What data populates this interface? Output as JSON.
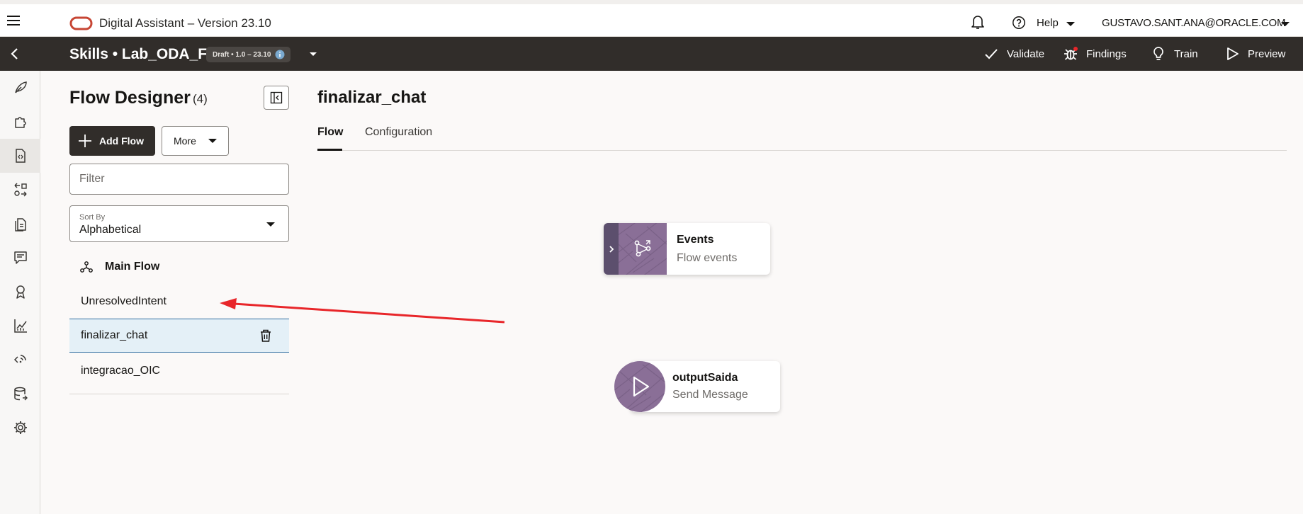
{
  "header": {
    "app_title": "Digital Assistant – Version 23.10",
    "help_label": "Help",
    "user": "GUSTAVO.SANT.ANA@ORACLE.COM"
  },
  "skillbar": {
    "title": "Skills • Lab_ODA_FT",
    "badge": "Draft • 1.0 – 23.10",
    "actions": {
      "validate": "Validate",
      "findings": "Findings",
      "train": "Train",
      "preview": "Preview"
    }
  },
  "rail": {
    "icons": [
      "feather-icon",
      "puzzle-icon",
      "flow-document-icon",
      "entities-icon",
      "resource-bundle-icon",
      "conversation-icon",
      "quality-badge-icon",
      "insights-chart-icon",
      "channels-icon",
      "data-store-icon",
      "settings-icon"
    ],
    "active_index": 2
  },
  "panel": {
    "title": "Flow Designer",
    "count": "(4)",
    "add_flow_label": "Add Flow",
    "more_label": "More",
    "filter_placeholder": "Filter",
    "sort_label": "Sort By",
    "sort_value": "Alphabetical",
    "main_flow": "Main Flow",
    "flows": [
      "UnresolvedIntent",
      "finalizar_chat",
      "integracao_OIC"
    ],
    "selected_flow": "finalizar_chat"
  },
  "content": {
    "flow_name": "finalizar_chat",
    "tabs": [
      "Flow",
      "Configuration"
    ],
    "active_tab": "Flow",
    "nodes": [
      {
        "title": "Events",
        "subtitle": "Flow events"
      },
      {
        "title": "outputSaida",
        "subtitle": "Send Message"
      }
    ]
  },
  "annotation": {
    "arrow_color": "#e8262a"
  }
}
